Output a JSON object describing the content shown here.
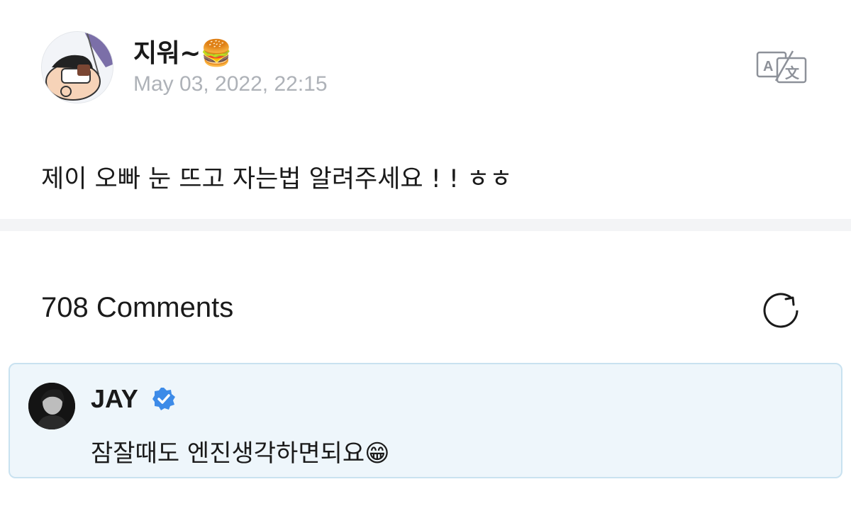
{
  "post": {
    "author": "지워~🍔",
    "timestamp": "May 03, 2022, 22:15",
    "body": "제이 오빠 눈 뜨고 자는법 알려주세요 ! ! ㅎㅎ",
    "icons": {
      "avatar": "cartoon-avatar",
      "translate": "translate-icon"
    }
  },
  "comments": {
    "count_label": "708 Comments",
    "refresh_icon": "refresh-icon"
  },
  "artist_comment": {
    "author": "JAY",
    "verified_icon": "verified-badge-icon",
    "text": "잠잘때도 엔진생각하면되요😁",
    "colors": {
      "background": "#eef6fb",
      "border": "#c9e2f0",
      "verified": "#3d8be8"
    }
  }
}
